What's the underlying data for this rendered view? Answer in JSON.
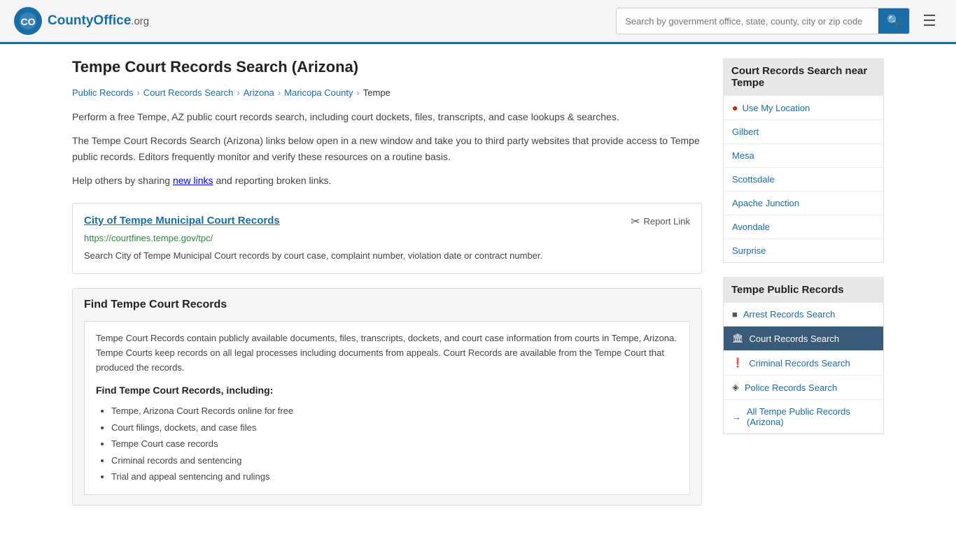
{
  "header": {
    "logo_text": "CountyOffice",
    "logo_suffix": ".org",
    "search_placeholder": "Search by government office, state, county, city or zip code",
    "search_value": ""
  },
  "page": {
    "title": "Tempe Court Records Search (Arizona)",
    "breadcrumbs": [
      {
        "label": "Public Records",
        "href": "#"
      },
      {
        "label": "Court Records Search",
        "href": "#"
      },
      {
        "label": "Arizona",
        "href": "#"
      },
      {
        "label": "Maricopa County",
        "href": "#"
      },
      {
        "label": "Tempe",
        "current": true
      }
    ],
    "description1": "Perform a free Tempe, AZ public court records search, including court dockets, files, transcripts, and case lookups & searches.",
    "description2": "The Tempe Court Records Search (Arizona) links below open in a new window and take you to third party websites that provide access to Tempe public records. Editors frequently monitor and verify these resources on a routine basis.",
    "description3_prefix": "Help others by sharing ",
    "new_links_label": "new links",
    "description3_suffix": " and reporting broken links.",
    "link_card": {
      "title": "City of Tempe Municipal Court Records",
      "url": "https://courtfines.tempe.gov/tpc/",
      "report_label": "Report Link",
      "description": "Search City of Tempe Municipal Court records by court case, complaint number, violation date or contract number."
    },
    "find_section": {
      "title": "Find Tempe Court Records",
      "body_text": "Tempe Court Records contain publicly available documents, files, transcripts, dockets, and court case information from courts in Tempe, Arizona. Tempe Courts keep records on all legal processes including documents from appeals. Court Records are available from the Tempe Court that produced the records.",
      "subtitle": "Find Tempe Court Records, including:",
      "list_items": [
        "Tempe, Arizona Court Records online for free",
        "Court filings, dockets, and case files",
        "Tempe Court case records",
        "Criminal records and sentencing",
        "Trial and appeal sentencing and rulings"
      ]
    }
  },
  "sidebar": {
    "nearby_section": {
      "title": "Court Records Search near Tempe",
      "use_location_label": "Use My Location",
      "locations": [
        {
          "label": "Gilbert"
        },
        {
          "label": "Mesa"
        },
        {
          "label": "Scottsdale"
        },
        {
          "label": "Apache Junction"
        },
        {
          "label": "Avondale"
        },
        {
          "label": "Surprise"
        }
      ]
    },
    "public_records_section": {
      "title": "Tempe Public Records",
      "items": [
        {
          "label": "Arrest Records Search",
          "icon": "■",
          "active": false
        },
        {
          "label": "Court Records Search",
          "icon": "🏛",
          "active": true
        },
        {
          "label": "Criminal Records Search",
          "icon": "❗",
          "active": false
        },
        {
          "label": "Police Records Search",
          "icon": "◈",
          "active": false
        },
        {
          "label": "All Tempe Public Records (Arizona)",
          "icon": "→",
          "active": false
        }
      ]
    }
  }
}
